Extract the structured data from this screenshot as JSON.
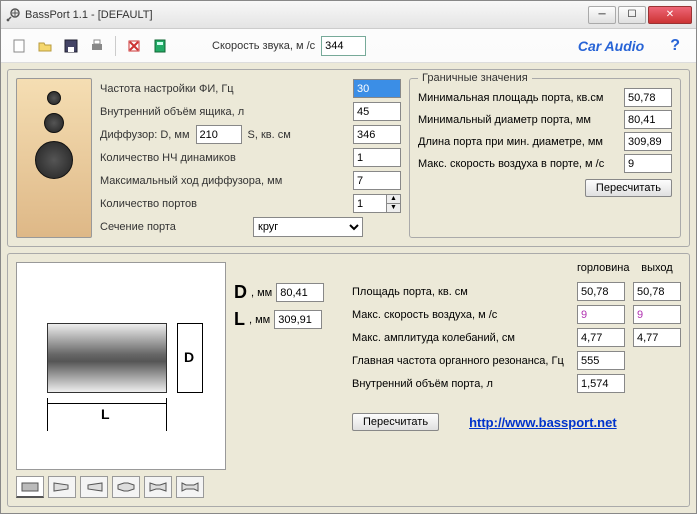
{
  "window": {
    "title": "BassPort 1.1 - [DEFAULT]"
  },
  "toolbar": {
    "sound_speed_label": "Скорость звука, м /с",
    "sound_speed": "344",
    "car_audio": "Car Audio",
    "help": "?"
  },
  "params": {
    "tune_freq_label": "Частота настройки ФИ, Гц",
    "tune_freq": "30",
    "box_vol_label": "Внутренний объём ящика, л",
    "box_vol": "45",
    "diff_d_label": "Диффузор: D, мм",
    "diff_d": "210",
    "s_label": "S, кв. cм",
    "s": "346",
    "num_woofers_label": "Количество НЧ динамиков",
    "num_woofers": "1",
    "xmax_label": "Максимальный ход диффузора, мм",
    "xmax": "7",
    "num_ports_label": "Количество портов",
    "num_ports": "1",
    "port_section_label": "Сечение порта",
    "port_section": "круг"
  },
  "limits": {
    "group_title": "Граничные значения",
    "min_area_label": "Минимальная площадь порта, кв.см",
    "min_area": "50,78",
    "min_dia_label": "Минимальный диаметр порта, мм",
    "min_dia": "80,41",
    "len_at_min_label": "Длина порта при мин. диаметре, мм",
    "len_at_min": "309,89",
    "max_air_label": "Макс. скорость воздуха в порте, м /с",
    "max_air": "9",
    "recalc": "Пересчитать"
  },
  "dl": {
    "D_label": "D",
    "L_label": "L",
    "unit": ", мм",
    "D": "80,41",
    "L": "309,91"
  },
  "results": {
    "col1": "горловина",
    "col2": "выход",
    "port_area_label": "Площадь порта, кв. см",
    "port_area_1": "50,78",
    "port_area_2": "50,78",
    "max_air_label": "Макс. скорость воздуха, м /с",
    "max_air_1": "9",
    "max_air_2": "9",
    "max_amp_label": "Макс. амплитуда колебаний, см",
    "max_amp_1": "4,77",
    "max_amp_2": "4,77",
    "organ_label": "Главная частота органного резонанса, Гц",
    "organ": "555",
    "port_vol_label": "Внутренний объём порта, л",
    "port_vol": "1,574",
    "recalc": "Пересчитать",
    "url": "http://www.bassport.net"
  }
}
